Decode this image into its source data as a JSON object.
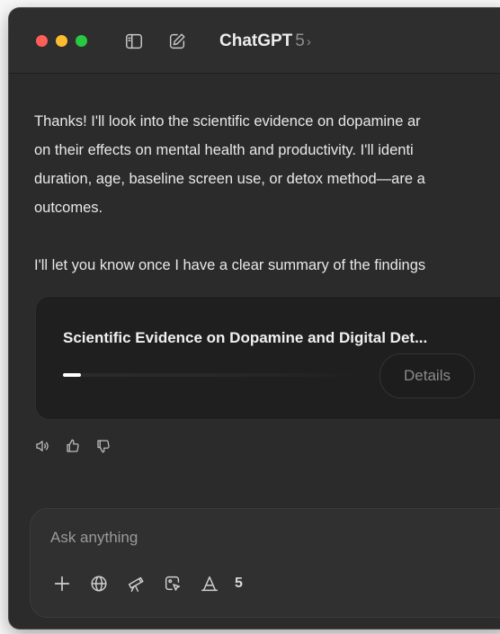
{
  "window": {
    "app_title": "ChatGPT",
    "version": "5",
    "chevron": "›"
  },
  "message": {
    "paragraph1_lines": [
      "Thanks! I'll look into the scientific evidence on dopamine ar",
      "on their effects on mental health and productivity. I'll identi",
      "duration, age, baseline screen use, or detox method—are a",
      "outcomes."
    ],
    "paragraph2": "I'll let you know once I have a clear summary of the findings"
  },
  "research_card": {
    "title": "Scientific Evidence on Dopamine and Digital Det...",
    "progress_fraction": 0.06,
    "details_label": "Details"
  },
  "feedback": {
    "icons": [
      "speaker-icon",
      "thumbs-up-icon",
      "thumbs-down-icon"
    ]
  },
  "composer": {
    "placeholder": "Ask anything",
    "tools": [
      "plus-icon",
      "globe-icon",
      "telescope-icon",
      "image-cursor-icon",
      "write-icon"
    ],
    "tool_count": "5"
  },
  "colors": {
    "window_bg": "#2b2b2b",
    "card_bg": "#1f1f1f",
    "composer_bg": "#303030",
    "traffic_red": "#ff5f57",
    "traffic_yellow": "#febc2e",
    "traffic_green": "#28c840"
  }
}
